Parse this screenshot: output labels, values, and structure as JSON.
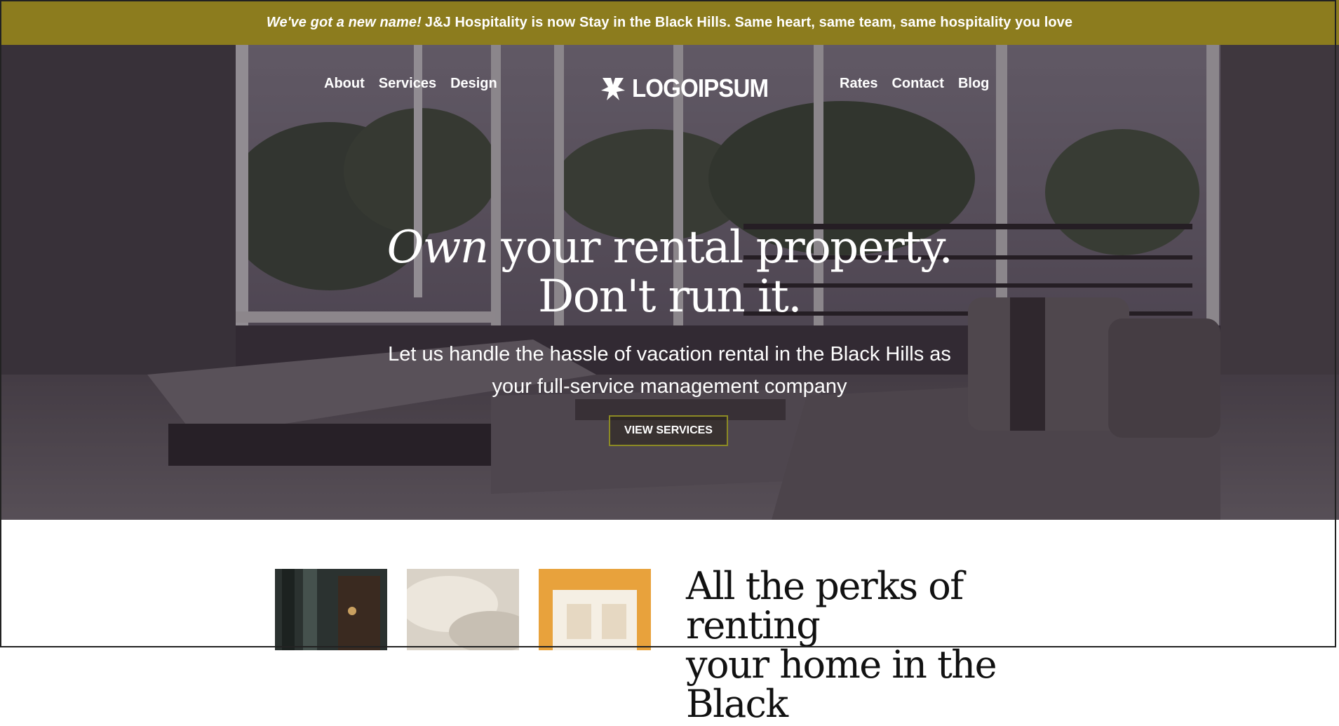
{
  "announcement": {
    "emphasis": "We've got a new name!",
    "text": "J&J Hospitality is now Stay in the Black Hills. Same heart, same team, same hospitality you love"
  },
  "nav": {
    "left": [
      "About",
      "Services",
      "Design"
    ],
    "right": [
      "Rates",
      "Contact",
      "Blog"
    ]
  },
  "logo": {
    "text": "LOGOIPSUM",
    "icon": "logo-mark-icon"
  },
  "hero": {
    "headline_italic": "Own",
    "headline_rest": "your rental property.",
    "headline_line2": "Don't run it.",
    "subtitle_line1": "Let us handle the hassle of vacation rental in the Black Hills as",
    "subtitle_line2": "your full-service management company",
    "cta_label": "VIEW SERVICES"
  },
  "perks": {
    "heading_line1": "All the perks of renting",
    "heading_line2": "your home in the Black"
  },
  "colors": {
    "announcement_bg": "#8c7c1e",
    "cta_border": "#8c8a24",
    "text_light": "#ffffff",
    "text_dark": "#111111"
  }
}
